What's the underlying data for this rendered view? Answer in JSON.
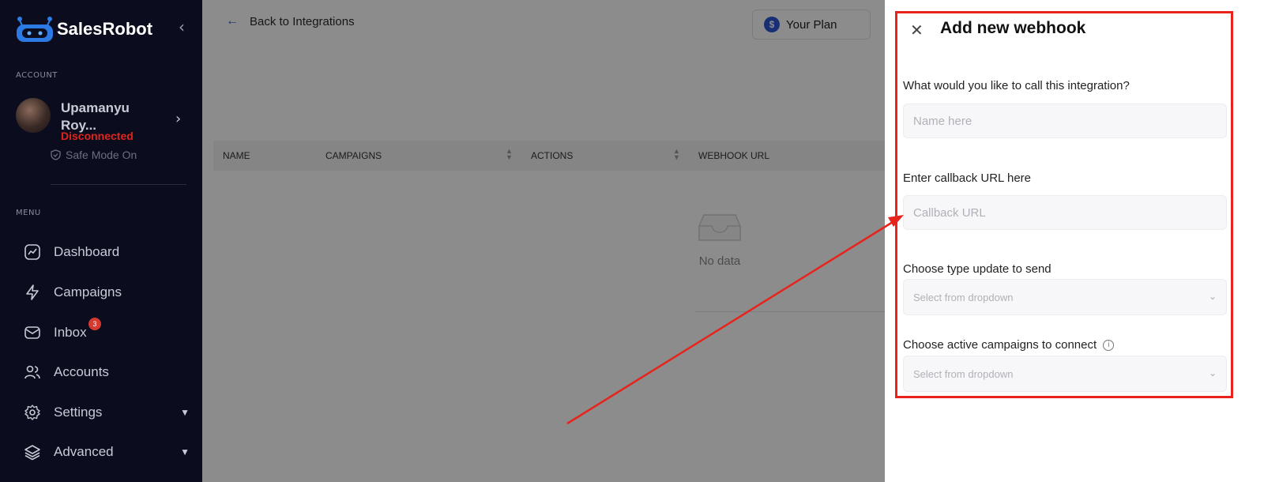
{
  "sidebar": {
    "brand": "SalesRobot",
    "account_label": "ACCOUNT",
    "user_name_line1": "Upamanyu",
    "user_name_line2": "Roy...",
    "user_status": "Disconnected",
    "safe_mode": "Safe Mode On",
    "menu_label": "MENU",
    "items": [
      {
        "label": "Dashboard",
        "icon": "dashboard-icon"
      },
      {
        "label": "Campaigns",
        "icon": "lightning-icon"
      },
      {
        "label": "Inbox",
        "icon": "inbox-icon",
        "badge": "3"
      },
      {
        "label": "Accounts",
        "icon": "users-icon"
      },
      {
        "label": "Settings",
        "icon": "gear-icon"
      },
      {
        "label": "Advanced",
        "icon": "layers-icon"
      }
    ]
  },
  "main": {
    "back_link": "Back to Integrations",
    "plan_button": "Your Plan",
    "plan_symbol": "$",
    "table_headers": [
      "NAME",
      "CAMPAIGNS",
      "ACTIONS",
      "WEBHOOK URL"
    ],
    "empty_text": "No data"
  },
  "drawer": {
    "title": "Add new webhook",
    "name_label": "What would you like to call this integration?",
    "name_placeholder": "Name here",
    "url_label": "Enter callback URL here",
    "url_placeholder": "Callback URL",
    "type_label": "Choose type update to send",
    "type_placeholder": "Select from dropdown",
    "campaigns_label": "Choose active campaigns to connect",
    "campaigns_placeholder": "Select from dropdown"
  },
  "colors": {
    "sidebar_bg": "#0b0c1d",
    "accent_blue": "#2f57d6",
    "status_red": "#e0241b",
    "highlight_red": "#e8231b"
  }
}
